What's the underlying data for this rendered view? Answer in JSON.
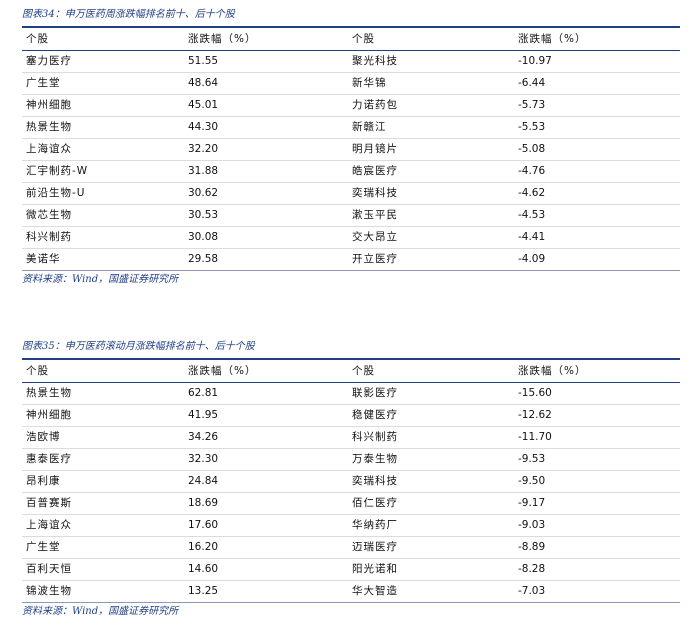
{
  "tables": [
    {
      "caption": "图表34：申万医药周涨跌幅排名前十、后十个股",
      "headers": [
        "个股",
        "涨跌幅（%）",
        "个股",
        "涨跌幅（%）"
      ],
      "rows": [
        [
          "塞力医疗",
          "51.55",
          "聚光科技",
          "-10.97"
        ],
        [
          "广生堂",
          "48.64",
          "新华锦",
          "-6.44"
        ],
        [
          "神州细胞",
          "45.01",
          "力诺药包",
          "-5.73"
        ],
        [
          "热景生物",
          "44.30",
          "新赣江",
          "-5.53"
        ],
        [
          "上海谊众",
          "32.20",
          "明月镜片",
          "-5.08"
        ],
        [
          "汇宇制药-W",
          "31.88",
          "皓宸医疗",
          "-4.76"
        ],
        [
          "前沿生物-U",
          "30.62",
          "奕瑞科技",
          "-4.62"
        ],
        [
          "微芯生物",
          "30.53",
          "漱玉平民",
          "-4.53"
        ],
        [
          "科兴制药",
          "30.08",
          "交大昂立",
          "-4.41"
        ],
        [
          "美诺华",
          "29.58",
          "开立医疗",
          "-4.09"
        ]
      ],
      "source": "资料来源：Wind，国盛证券研究所"
    },
    {
      "caption": "图表35：申万医药滚动月涨跌幅排名前十、后十个股",
      "headers": [
        "个股",
        "涨跌幅（%）",
        "个股",
        "涨跌幅（%）"
      ],
      "rows": [
        [
          "热景生物",
          "62.81",
          "联影医疗",
          "-15.60"
        ],
        [
          "神州细胞",
          "41.95",
          "稳健医疗",
          "-12.62"
        ],
        [
          "浩欧博",
          "34.26",
          "科兴制药",
          "-11.70"
        ],
        [
          "惠泰医疗",
          "32.30",
          "万泰生物",
          "-9.53"
        ],
        [
          "昂利康",
          "24.84",
          "奕瑞科技",
          "-9.50"
        ],
        [
          "百普赛斯",
          "18.69",
          "佰仁医疗",
          "-9.17"
        ],
        [
          "上海谊众",
          "17.60",
          "华纳药厂",
          "-9.03"
        ],
        [
          "广生堂",
          "16.20",
          "迈瑞医疗",
          "-8.89"
        ],
        [
          "百利天恒",
          "14.60",
          "阳光诺和",
          "-8.28"
        ],
        [
          "锦波生物",
          "13.25",
          "华大智造",
          "-7.03"
        ]
      ],
      "source": "资料来源：Wind，国盛证券研究所"
    }
  ]
}
